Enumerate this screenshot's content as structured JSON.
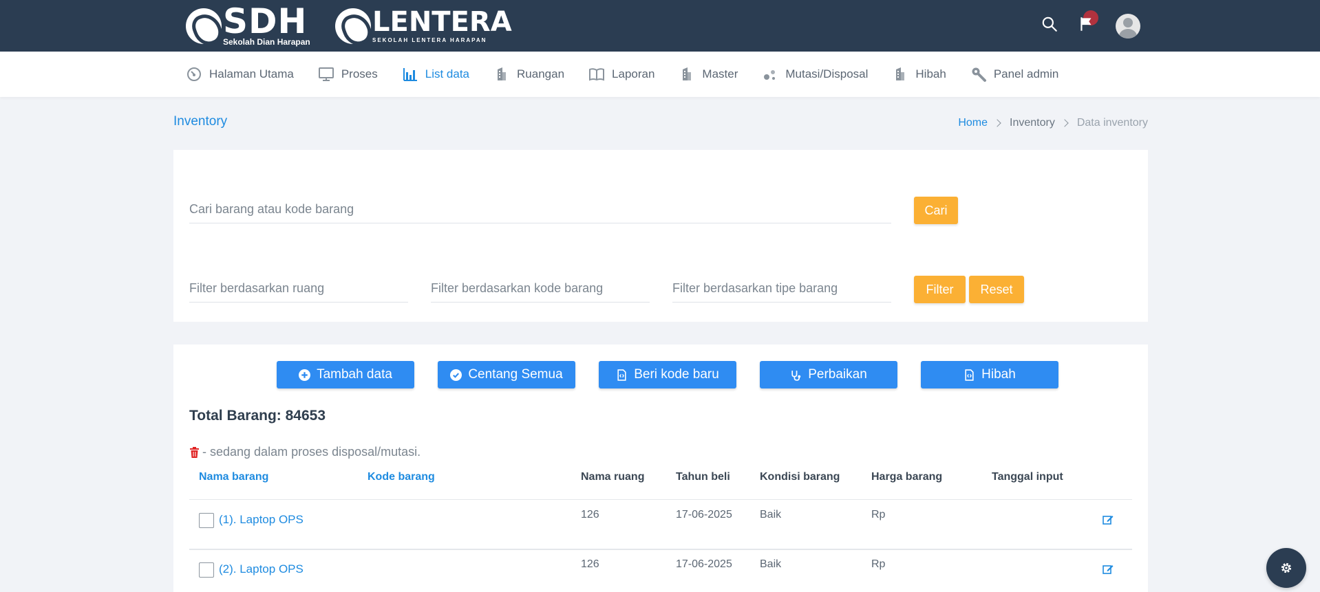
{
  "header": {
    "logos": [
      {
        "mark": "SDH",
        "subtitle": "Sekolah Dian Harapan"
      },
      {
        "mark": "LENTERA",
        "subtitle": "SEKOLAH LENTERA HARAPAN"
      }
    ],
    "icons": [
      "search-icon",
      "notification-flag-icon",
      "user-avatar"
    ],
    "accent_color": "#2b3d52"
  },
  "menu": {
    "items": [
      {
        "label": "Halaman Utama",
        "icon": "dashboard-icon",
        "active": false
      },
      {
        "label": "Proses",
        "icon": "monitor-icon",
        "active": false
      },
      {
        "label": "List data",
        "icon": "bar-chart-icon",
        "active": true
      },
      {
        "label": "Ruangan",
        "icon": "building-icon",
        "active": false
      },
      {
        "label": "Laporan",
        "icon": "book-icon",
        "active": false
      },
      {
        "label": "Master",
        "icon": "building-icon",
        "active": false
      },
      {
        "label": "Mutasi/Disposal",
        "icon": "dots-icon",
        "active": false
      },
      {
        "label": "Hibah",
        "icon": "building-icon",
        "active": false
      },
      {
        "label": "Panel admin",
        "icon": "wrench-icon",
        "active": false
      }
    ]
  },
  "page": {
    "title": "Inventory",
    "breadcrumb": [
      "Home",
      "Inventory",
      "Data inventory"
    ]
  },
  "search": {
    "placeholder": "Cari barang atau kode barang",
    "button": "Cari"
  },
  "filters": {
    "room_placeholder": "Filter berdasarkan ruang",
    "code_placeholder": "Filter berdasarkan kode barang",
    "type_placeholder": "Filter berdasarkan tipe barang",
    "filter_button": "Filter",
    "reset_button": "Reset"
  },
  "actions": {
    "add": "Tambah data",
    "check_all": "Centang Semua",
    "new_code": "Beri kode baru",
    "repair": "Perbaikan",
    "grant": "Hibah"
  },
  "list": {
    "total_label": "Total Barang: 84653",
    "disposal_note": "- sedang dalam proses disposal/mutasi.",
    "columns": {
      "name": "Nama barang",
      "code": "Kode barang",
      "room": "Nama ruang",
      "year": "Tahun beli",
      "condition": "Kondisi barang",
      "price": "Harga barang",
      "input_date": "Tanggal input"
    },
    "rows": [
      {
        "name": "(1). Laptop OPS",
        "code": "",
        "room": "126",
        "year": "17-06-2025",
        "condition": "Baik",
        "price": "Rp",
        "input_date": ""
      },
      {
        "name": "(2). Laptop OPS",
        "code": "",
        "room": "126",
        "year": "17-06-2025",
        "condition": "Baik",
        "price": "Rp",
        "input_date": ""
      }
    ]
  },
  "colors": {
    "primary": "#2f8cf2",
    "link": "#1e8be0",
    "warning": "#fbb034",
    "danger": "#e02424"
  }
}
